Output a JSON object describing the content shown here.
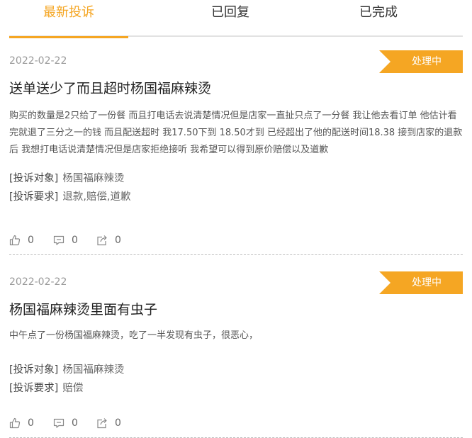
{
  "tabs": [
    {
      "label": "最新投诉"
    },
    {
      "label": "已回复"
    },
    {
      "label": "已完成"
    }
  ],
  "labels": {
    "target": "[投诉对象]",
    "demand": "[投诉要求]"
  },
  "complaints": [
    {
      "date": "2022-02-22",
      "status": "处理中",
      "title": "送单送少了而且超时杨国福麻辣烫",
      "desc": "购买的数量是2只给了一份餐 而且打电话去说清楚情况但是店家一直扯只点了一分餐 我让他去看订单 他估计看完就退了三分之一的钱 而且配送超时 我17.50下到 18.50才到 已经超出了他的配送时间18.38 接到店家的退款后 我想打电话说清楚情况但是店家拒绝接听 我希望可以得到原价赔偿以及道歉",
      "target": "杨国福麻辣烫",
      "demand": "退款,赔偿,道歉",
      "likes": "0",
      "comments": "0",
      "shares": "0"
    },
    {
      "date": "2022-02-22",
      "status": "处理中",
      "title": "杨国福麻辣烫里面有虫子",
      "desc": "中午点了一份杨国福麻辣烫，吃了一半发现有虫子，很恶心，",
      "target": "杨国福麻辣烫",
      "demand": "赔偿",
      "likes": "0",
      "comments": "0",
      "shares": "0"
    }
  ],
  "colors": {
    "accent": "#f5a623"
  },
  "icons": [
    "thumbs-up-icon",
    "comment-icon",
    "share-icon"
  ]
}
